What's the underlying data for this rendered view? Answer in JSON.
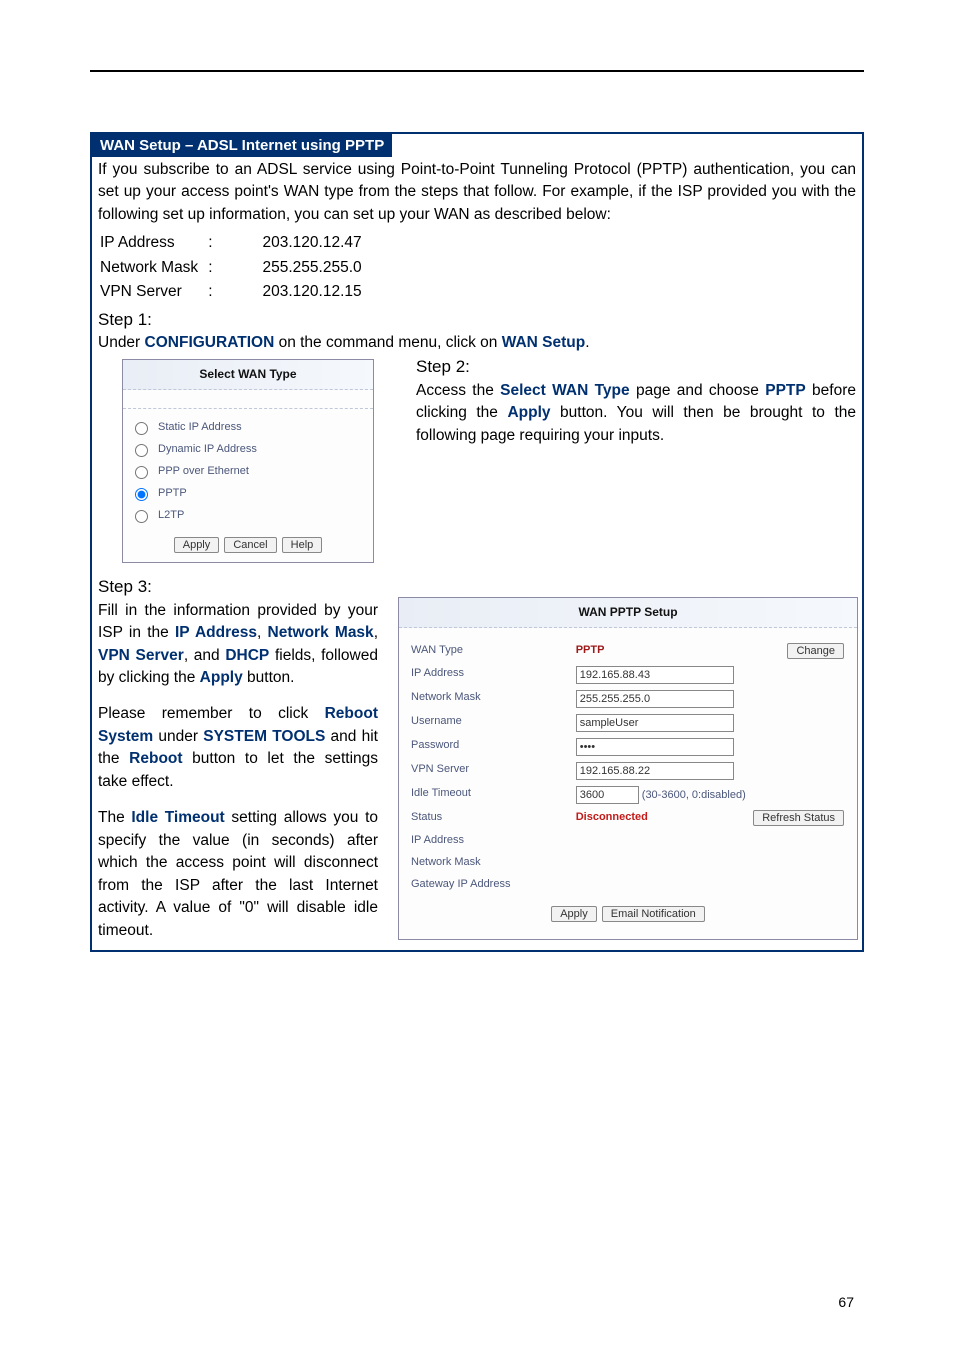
{
  "page_number": "67",
  "ribbon_title": "WAN Setup – ADSL Internet using PPTP",
  "intro": "If you subscribe to an ADSL service using Point-to-Point Tunneling Protocol (PPTP) authentication, you can set up your access point's WAN type from the steps that follow. For example, if the ISP provided you with the following set up information, you can set up your WAN as described below:",
  "ip_info": {
    "ip_label": "IP Address",
    "ip_val": "203.120.12.47",
    "mask_label": "Network Mask",
    "mask_val": "255.255.255.0",
    "vpn_label": "VPN Server",
    "vpn_val": "203.120.12.15"
  },
  "step1_label": "Step 1:",
  "step1_under": "Under ",
  "step1_conf": "CONFIGURATION",
  "step1_mid": " on the command menu, click on ",
  "step1_wan": "WAN Setup",
  "step1_end": ".",
  "step2_label": "Step 2:",
  "step2_a": "Access the ",
  "step2_sel": "Select WAN Type",
  "step2_b": " page and choose ",
  "step2_pptp": "PPTP",
  "step2_c": " before clicking the ",
  "step2_apply": "Apply",
  "step2_d": " button.  You will then be brought to the following page requiring your inputs.",
  "step3_label": "Step 3:",
  "step3_p1a": "Fill in the information provided by your ISP in the ",
  "step3_ip": "IP Address",
  "step3_sep1": ", ",
  "step3_mask": "Network Mask",
  "step3_sep2": ", ",
  "step3_vpn": "VPN Server",
  "step3_sep3": ", and ",
  "step3_dhcp": "DHCP",
  "step3_p1b": " fields, followed by clicking the ",
  "step3_apply": "Apply",
  "step3_p1c": " button.",
  "step3_p2a": "Please remember to click ",
  "step3_reboot": "Reboot System",
  "step3_p2b": " under ",
  "step3_tools": "SYSTEM TOOLS",
  "step3_p2c": " and hit the ",
  "step3_rebootbtn": "Reboot",
  "step3_p2d": " button to let the settings take effect.",
  "step3_p3a": "The ",
  "step3_idle": "Idle Timeout",
  "step3_p3b": " setting allows you to specify the value (in seconds) after which the access point will disconnect from the ISP after the last Internet activity. A value of \"0\" will disable idle timeout.",
  "fig1": {
    "title": "Select WAN Type",
    "opts": [
      "Static IP Address",
      "Dynamic IP Address",
      "PPP over Ethernet",
      "PPTP",
      "L2TP"
    ],
    "selected": 3,
    "btn_apply": "Apply",
    "btn_cancel": "Cancel",
    "btn_help": "Help"
  },
  "fig2": {
    "title": "WAN PPTP Setup",
    "rows": {
      "wan_type_label": "WAN Type",
      "wan_type_val": "PPTP",
      "change_btn": "Change",
      "ip_label": "IP Address",
      "ip_val": "192.165.88.43",
      "mask_label": "Network Mask",
      "mask_val": "255.255.255.0",
      "user_label": "Username",
      "user_val": "sampleUser",
      "pass_label": "Password",
      "pass_val": "••••",
      "vpn_label": "VPN Server",
      "vpn_val": "192.165.88.22",
      "idle_label": "Idle Timeout",
      "idle_val": "3600",
      "idle_hint": "(30-3600, 0:disabled)",
      "status_label": "Status",
      "status_val": "Disconnected",
      "refresh_btn": "Refresh Status",
      "ip2_label": "IP Address",
      "mask2_label": "Network Mask",
      "gw_label": "Gateway IP Address"
    },
    "btn_apply": "Apply",
    "btn_email": "Email Notification"
  }
}
